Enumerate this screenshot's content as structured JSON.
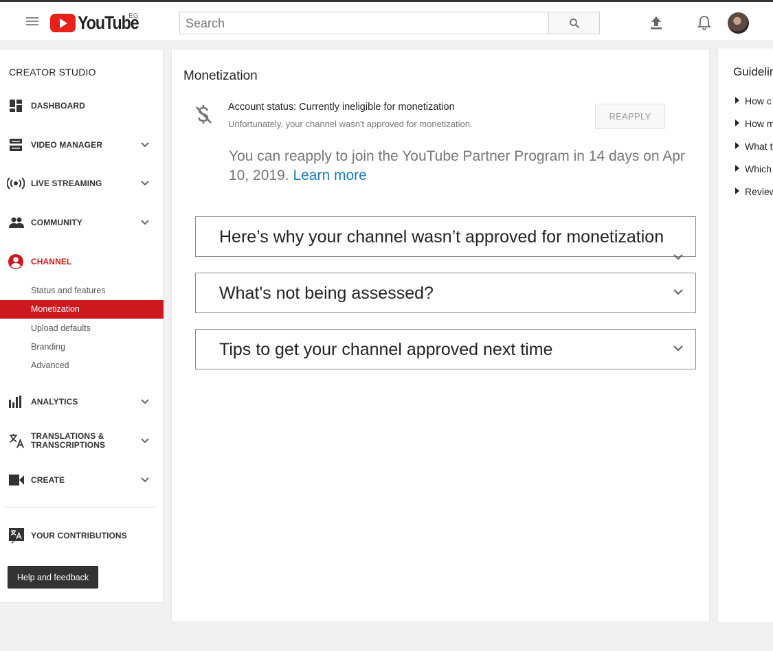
{
  "header": {
    "logo_text": "YouTube",
    "country_code": "EG",
    "search_placeholder": "Search"
  },
  "sidebar": {
    "title": "CREATOR STUDIO",
    "items": [
      {
        "label": "DASHBOARD",
        "icon": "dashboard-icon"
      },
      {
        "label": "VIDEO MANAGER",
        "icon": "video-manager-icon"
      },
      {
        "label": "LIVE STREAMING",
        "icon": "live-streaming-icon"
      },
      {
        "label": "COMMUNITY",
        "icon": "community-icon"
      },
      {
        "label": "CHANNEL",
        "icon": "channel-icon",
        "active": true
      },
      {
        "label": "ANALYTICS",
        "icon": "analytics-icon"
      },
      {
        "label": "TRANSLATIONS & TRANSCRIPTIONS",
        "icon": "translate-icon"
      },
      {
        "label": "CREATE",
        "icon": "create-camera-icon"
      },
      {
        "label": "YOUR CONTRIBUTIONS",
        "icon": "contributions-icon"
      }
    ],
    "channel_sub": [
      "Status and features",
      "Monetization",
      "Upload defaults",
      "Branding",
      "Advanced"
    ],
    "help_label": "Help and feedback"
  },
  "main": {
    "title": "Monetization",
    "status_line": "Account status: Currently ineligible for monetization",
    "status_sub": "Unfortunately, your channel wasn't approved for monetization.",
    "reapply_label": "REAPPLY",
    "reapply_info": "You can reapply to join the YouTube Partner Program in 14 days on Apr 10, 2019.",
    "learn_more": "Learn more",
    "accordions": [
      "Here’s why your channel wasn’t approved for monetization",
      "What's not being assessed?",
      "Tips to get your channel approved next time"
    ]
  },
  "right": {
    "title": "Guidelin",
    "items": [
      "How c",
      "How m",
      "What t",
      "Which",
      "Review"
    ]
  },
  "colors": {
    "brand_red": "#cc181e",
    "link_blue": "#167ac6"
  }
}
